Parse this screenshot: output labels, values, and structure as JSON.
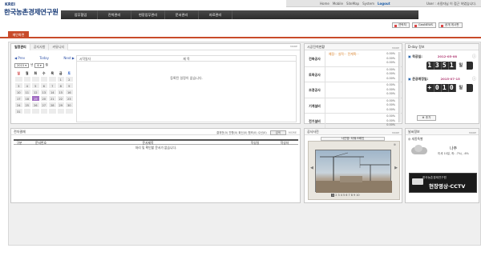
{
  "header": {
    "logo_en": "KREI",
    "logo_kr": "한국농촌경제연구원",
    "util_links": [
      "Home",
      "Mobile",
      "SiteMap",
      "System"
    ],
    "logout": "Logout",
    "user_info": "User : 사용자님 이 접근 하였습니다.",
    "nav": [
      "업무협업",
      "진척관리",
      "현장업무관리",
      "문서관리",
      "자료관리"
    ]
  },
  "top_buttons": [
    "연락처",
    "GeoNEWS",
    "공개 게시판"
  ],
  "active_tab": "메인화면",
  "schedule": {
    "tabs": [
      "일정관리",
      "공지사항",
      "커뮤니티"
    ],
    "more": "MORE",
    "prev": "◀ Prev",
    "today": "Today",
    "next": "Next ▶",
    "year": "2015",
    "month": "6",
    "weekdays": [
      "일",
      "월",
      "화",
      "수",
      "목",
      "금",
      "토"
    ],
    "weeks": [
      [
        "",
        "",
        "",
        "",
        "",
        "1",
        "2"
      ],
      [
        "3",
        "4",
        "5",
        "6",
        "7",
        "8",
        "9"
      ],
      [
        "10",
        "11",
        "12",
        "13",
        "14",
        "15",
        "16"
      ],
      [
        "17",
        "18",
        "19",
        "20",
        "21",
        "22",
        "23"
      ],
      [
        "24",
        "25",
        "26",
        "27",
        "28",
        "29",
        "30"
      ],
      [
        "31",
        "",
        "",
        "",
        "",
        "",
        ""
      ]
    ],
    "today_day": "19",
    "col_date": "시작일자",
    "col_title": "제 목",
    "empty_msg": "등록된 일정이 없습니다."
  },
  "construction": {
    "title": "시공진척현황",
    "more": "MORE",
    "notice": "예정···  실적···  전계획···",
    "rows": [
      {
        "label": "건축공사",
        "vals": [
          "0.00%",
          "0.00%",
          "0.00%"
        ]
      },
      {
        "label": "토목공사",
        "vals": [
          "0.00%",
          "0.00%",
          "0.00%"
        ]
      },
      {
        "label": "조경공사",
        "vals": [
          "0.00%",
          "0.00%",
          "0.00%"
        ]
      },
      {
        "label": "기계설비",
        "vals": [
          "0.00%",
          "0.00%",
          "0.00%"
        ]
      },
      {
        "label": "전기설비",
        "vals": [
          "0.00%",
          "0.00%",
          "0.00%"
        ]
      }
    ]
  },
  "dday": {
    "title": "D-day 정보",
    "items": [
      {
        "label": "착공일:",
        "date": "2012-05-08",
        "digits": [
          "1",
          "3",
          "5",
          "1",
          "일"
        ]
      },
      {
        "label": "준공예정일:",
        "date": "2015-07-15",
        "digits": [
          "+",
          "0",
          "1",
          "0",
          "일"
        ]
      }
    ],
    "add": "⊕ 추가"
  },
  "docs": {
    "title": "전자결재",
    "more": "MORE",
    "filters": "결재전(0)  진행(0)  회신(0)  협조(0)  수신(0)",
    "search": "검색",
    "cols": [
      "구분",
      "문서번호",
      "문서제목",
      "작성일",
      "작성자"
    ],
    "empty_msg": "처리 및 확인할 문서가 없습니다."
  },
  "photo": {
    "title": "공사사진",
    "more": "MORE",
    "caption": "사진명: 타워크레인",
    "pages": [
      "1",
      "2",
      "3",
      "4",
      "5",
      "6",
      "7",
      "8",
      "9",
      "10"
    ]
  },
  "weather": {
    "title": "날씨정보",
    "more": "MORE",
    "location": "◎ 세종특별",
    "desc": "나주",
    "temp": "미세 10일, 최: -7%/, -6%",
    "cctv_org": "한국농촌경제연구원",
    "cctv_label": "현장영상·CCTV"
  }
}
